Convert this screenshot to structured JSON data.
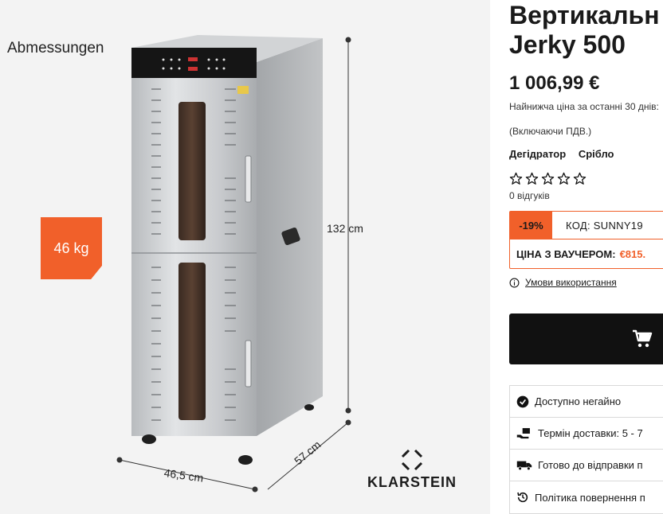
{
  "image": {
    "dimensions_title": "Abmessungen",
    "weight": "46 kg",
    "height_label": "132 cm",
    "width_label": "46,5 cm",
    "depth_label": "57 cm",
    "brand_name": "KLARSTEIN"
  },
  "product": {
    "title_line1": "Вертикальн",
    "title_line2": "Jerky 500",
    "price": "1 006,99 €",
    "lowest_price_note": "Найнижча ціна за останні 30 днів:",
    "vat_note": "(Включаючи ПДВ.)",
    "category": "Дегідратор",
    "color": "Срібло",
    "rating_stars": 0,
    "reviews": "0 відгуків"
  },
  "voucher": {
    "discount": "-19%",
    "code_text": "КОД: SUNNY19",
    "price_label": "ЦІНА З ВАУЧЕРОМ:",
    "price_value": "€815."
  },
  "terms_link": "Умови використання",
  "info": {
    "available": "Доступно негайно",
    "delivery": "Термін доставки: 5 - 7",
    "ready": "Готово до відправки п",
    "returns": "Політика повернення п"
  },
  "colors": {
    "accent": "#f1602a",
    "button": "#111111"
  }
}
